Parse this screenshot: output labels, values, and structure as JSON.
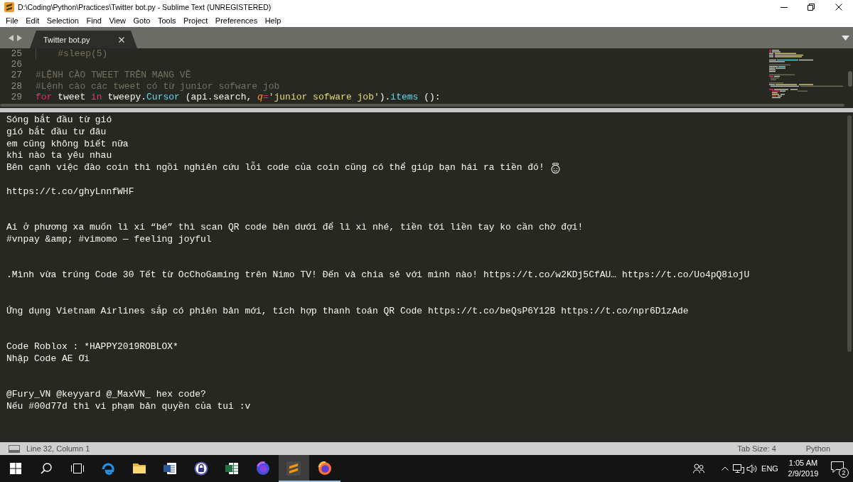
{
  "window": {
    "title": "D:\\Coding\\Python\\Practices\\Twitter bot.py - Sublime Text (UNREGISTERED)"
  },
  "menu": [
    {
      "label": "File"
    },
    {
      "label": "Edit"
    },
    {
      "label": "Selection"
    },
    {
      "label": "Find"
    },
    {
      "label": "View"
    },
    {
      "label": "Goto"
    },
    {
      "label": "Tools"
    },
    {
      "label": "Project"
    },
    {
      "label": "Preferences"
    },
    {
      "label": "Help"
    }
  ],
  "tabs": [
    {
      "label": "Twitter bot.py",
      "selected": true
    }
  ],
  "editor": {
    "lines": [
      {
        "number": "25",
        "indented": true,
        "tokens": [
          {
            "kind": "comment",
            "text": "#sleep(5)"
          }
        ]
      },
      {
        "number": "26",
        "indented": false
      },
      {
        "number": "27",
        "indented": false,
        "tokens": [
          {
            "kind": "comment",
            "text": "#LỆNH CÀO TWEET TRÊN MẠNG VỀ"
          }
        ]
      },
      {
        "number": "28",
        "indented": false,
        "tokens": [
          {
            "kind": "comment",
            "text": "#Lệnh cào các tweet có từ junior sofware job"
          }
        ]
      },
      {
        "number": "29",
        "indented": false,
        "tokens": [
          {
            "kind": "keyword",
            "text": "for"
          },
          {
            "kind": "plain",
            "text": " tweet "
          },
          {
            "kind": "keyword",
            "text": "in"
          },
          {
            "kind": "plain",
            "text": " tweepy."
          },
          {
            "kind": "call",
            "text": "Cursor"
          },
          {
            "kind": "plain",
            "text": " (api.search, "
          },
          {
            "kind": "param",
            "text": "q"
          },
          {
            "kind": "keyword",
            "text": "="
          },
          {
            "kind": "string",
            "text": "'junior sofware job'"
          },
          {
            "kind": "plain",
            "text": ")."
          },
          {
            "kind": "call",
            "text": "items"
          },
          {
            "kind": "plain",
            "text": " ():"
          }
        ]
      }
    ]
  },
  "output": {
    "blocks": [
      {
        "paragraphs": [
          [
            {
              "text": "Sóng bắt đầu từ gió",
              "trailing_emoji": false
            },
            {
              "text": "gió bắt đầu tư đâu",
              "trailing_emoji": false
            },
            {
              "text": "em cũng không biết nữa",
              "trailing_emoji": false
            },
            {
              "text": "khi nào ta yêu nhau",
              "trailing_emoji": false
            },
            {
              "text": "Bên cạnh việc đào coin thì ngồi nghiên cứu lỗi code của coin cũng có thể giúp bạn hái ra tiền đó!",
              "trailing_emoji": true
            }
          ],
          [
            {
              "text": "https://t.co/ghyLnnfWHF",
              "trailing_emoji": false
            }
          ]
        ]
      },
      {
        "paragraphs": [
          [
            {
              "text": "Ai ở phương xa muốn lì xi “bé” thì scan QR code bên dưới để lì xì nhé, tiền tới liền tay ko cần chờ đợi!",
              "trailing_emoji": false
            },
            {
              "text": "#vnpay &amp; #vimomo — feeling joyful",
              "trailing_emoji": false
            }
          ]
        ]
      },
      {
        "paragraphs": [
          [
            {
              "text": ".Mình vừa trúng Code 30 Tết từ OcChoGaming trên Nimo TV! Đến và chia sẻ với mình nào! https://t.co/w2KDj5CfAU… https://t.co/Uo4pQ8iojU",
              "trailing_emoji": false
            }
          ]
        ]
      },
      {
        "paragraphs": [
          [
            {
              "text": "Ứng dụng Vietnam Airlines sắp có phiên bản mới, tích hợp thanh toán QR Code https://t.co/beQsP6Y12B https://t.co/npr6D1zAde",
              "trailing_emoji": false
            }
          ]
        ]
      },
      {
        "paragraphs": [
          [
            {
              "text": "Code Roblox : *HAPPY2019ROBLOX*",
              "trailing_emoji": false
            },
            {
              "text": "Nhập Code AE Ơi",
              "trailing_emoji": false
            }
          ]
        ]
      },
      {
        "paragraphs": [
          [
            {
              "text": "@Fury_VN @keyyard @_MaxVN_ hex code?",
              "trailing_emoji": false
            },
            {
              "text": "Nếu #00d77d thì vi phạm bản quyền của tui :v",
              "trailing_emoji": false
            }
          ]
        ]
      }
    ]
  },
  "status_bar": {
    "position": "Line 32, Column 1",
    "tab_size": "Tab Size: 4",
    "syntax": "Python"
  },
  "taskbar": {
    "apps": [
      {
        "kind": "edge",
        "running": false,
        "selected": false
      },
      {
        "kind": "folder",
        "running": false,
        "selected": false
      },
      {
        "kind": "word",
        "running": false,
        "selected": false
      },
      {
        "kind": "lock",
        "running": false,
        "selected": false
      },
      {
        "kind": "excel",
        "running": false,
        "selected": false
      },
      {
        "kind": "nightly",
        "running": false,
        "selected": false
      },
      {
        "kind": "sublime",
        "running": true,
        "selected": true
      },
      {
        "kind": "firefox",
        "running": true,
        "selected": false
      }
    ],
    "language": "ENG",
    "time": "1:05 AM",
    "date": "2/9/2019",
    "notifications": "2"
  }
}
